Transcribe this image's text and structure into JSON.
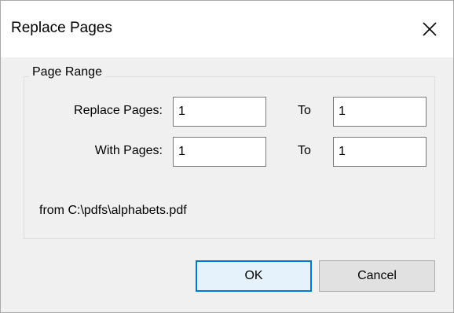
{
  "dialog": {
    "title": "Replace Pages",
    "close_icon": "close-icon"
  },
  "page_range": {
    "legend": "Page Range",
    "replace_label": "Replace Pages:",
    "replace_from": "1",
    "replace_to_label": "To",
    "replace_to": "1",
    "with_label": "With Pages:",
    "with_from": "1",
    "with_to_label": "To",
    "with_to": "1",
    "source_text": "from C:\\pdfs\\alphabets.pdf"
  },
  "buttons": {
    "ok_label": "OK",
    "cancel_label": "Cancel"
  },
  "colors": {
    "default_button_border": "#0078d7",
    "default_button_fill": "#e5f1fb",
    "dialog_background": "#f0f0f0"
  }
}
